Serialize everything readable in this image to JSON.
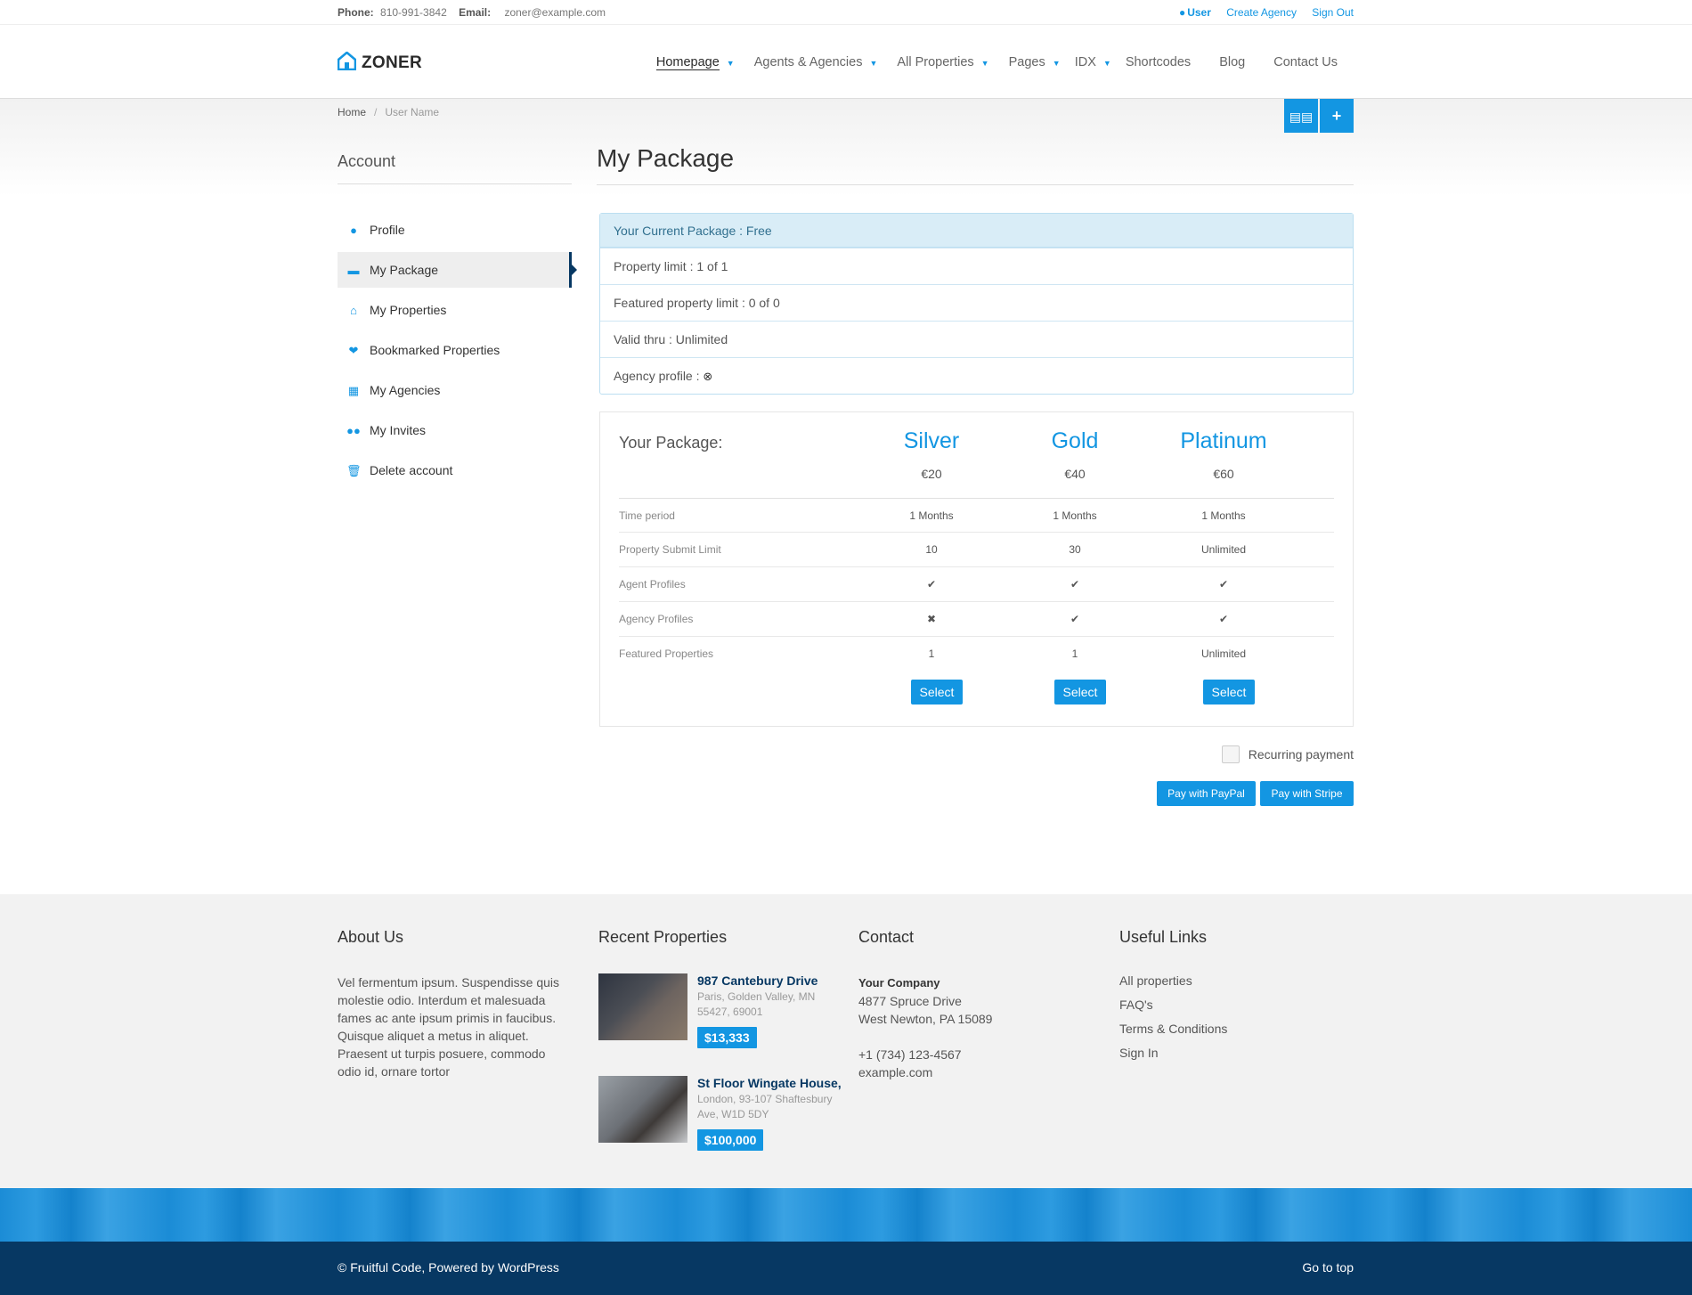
{
  "topbar": {
    "phone_label": "Phone:",
    "phone": "810-991-3842",
    "email_label": "Email:",
    "email": "zoner@example.com",
    "user": "User",
    "create_agency": "Create Agency",
    "sign_out": "Sign Out"
  },
  "header": {
    "logo": "ZONER",
    "nav": [
      "Homepage",
      "Agents & Agencies",
      "All Properties",
      "Pages",
      "IDX",
      "Shortcodes",
      "Blog",
      "Contact Us"
    ]
  },
  "breadcrumb": {
    "home": "Home",
    "current": "User Name"
  },
  "sidebar": {
    "title": "Account",
    "items": [
      {
        "label": "Profile",
        "icon": "user-icon"
      },
      {
        "label": "My Package",
        "icon": "credit-card-icon"
      },
      {
        "label": "My Properties",
        "icon": "home-icon"
      },
      {
        "label": "Bookmarked Properties",
        "icon": "heart-icon"
      },
      {
        "label": "My Agencies",
        "icon": "building-icon"
      },
      {
        "label": "My Invites",
        "icon": "users-icon"
      },
      {
        "label": "Delete account",
        "icon": "trash-icon"
      }
    ]
  },
  "main": {
    "title": "My Package",
    "current_package": {
      "header": "Your Current Package : Free",
      "rows": [
        "Property limit : 1 of 1",
        "Featured property limit : 0 of 0",
        "Valid thru : Unlimited",
        "Agency profile :"
      ]
    },
    "packages": {
      "title": "Your Package:",
      "plans": [
        {
          "name": "Silver",
          "price": "€20"
        },
        {
          "name": "Gold",
          "price": "€40"
        },
        {
          "name": "Platinum",
          "price": "€60"
        }
      ],
      "rows": [
        {
          "label": "Time period",
          "values": [
            "1 Months",
            "1 Months",
            "1 Months"
          ]
        },
        {
          "label": "Property Submit Limit",
          "values": [
            "10",
            "30",
            "Unlimited"
          ]
        },
        {
          "label": "Agent Profiles",
          "values": [
            "✔",
            "✔",
            "✔"
          ]
        },
        {
          "label": "Agency Profiles",
          "values": [
            "✖",
            "✔",
            "✔"
          ]
        },
        {
          "label": "Featured Properties",
          "values": [
            "1",
            "1",
            "Unlimited"
          ]
        }
      ],
      "select_label": "Select"
    },
    "recurring_label": "Recurring payment",
    "pay_paypal": "Pay with PayPal",
    "pay_stripe": "Pay with Stripe"
  },
  "footer": {
    "about": {
      "title": "About Us",
      "text": "Vel fermentum ipsum. Suspendisse quis molestie odio. Interdum et malesuada fames ac ante ipsum primis in faucibus. Quisque aliquet a metus in aliquet. Praesent ut turpis posuere, commodo odio id, ornare tortor"
    },
    "recent": {
      "title": "Recent Properties",
      "items": [
        {
          "name": "987 Cantebury Drive",
          "address": "Paris, Golden Valley, MN 55427, 69001",
          "price": "$13,333"
        },
        {
          "name": "St Floor Wingate House,",
          "address": "London, 93-107 Shaftesbury Ave, W1D 5DY",
          "price": "$100,000"
        }
      ]
    },
    "contact": {
      "title": "Contact",
      "company": "Your Company",
      "street": "4877 Spruce Drive",
      "city": "West Newton, PA 15089",
      "phone": "+1 (734) 123-4567",
      "site": "example.com"
    },
    "links": {
      "title": "Useful Links",
      "items": [
        "All properties",
        "FAQ's",
        "Terms & Conditions",
        "Sign In"
      ]
    }
  },
  "bottom": {
    "copyright": "© Fruitful Code, Powered by WordPress",
    "go_top": "Go to top"
  }
}
